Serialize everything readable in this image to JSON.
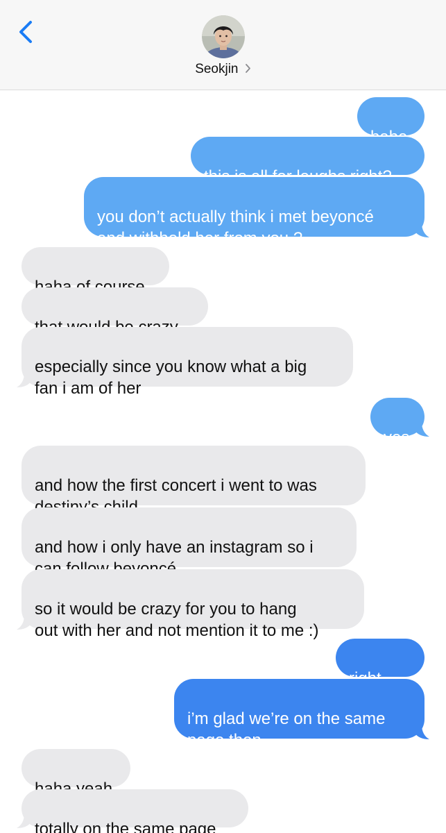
{
  "header": {
    "contact_name": "Seokjin",
    "icons": {
      "back": "chevron-left-icon",
      "contact_details": "chevron-right-icon",
      "avatar": "contact-avatar"
    },
    "colors": {
      "accent": "#1a7cf5",
      "background": "#f7f7f7"
    }
  },
  "conversation": {
    "colors": {
      "sent_bubble": "#5ea9f3",
      "sent_bubble_latest": "#3c85ef",
      "received_bubble": "#e9e9eb"
    },
    "messages": [
      {
        "from": "me",
        "text": "babe"
      },
      {
        "from": "me",
        "text": "this is all for laughs right?"
      },
      {
        "from": "me",
        "text": "you don’t actually think i met beyoncé\nand withheld her from you ?"
      },
      {
        "from": "them",
        "text": "haha of course"
      },
      {
        "from": "them",
        "text": "that would be crazy"
      },
      {
        "from": "them",
        "text": "especially since you know what a big\nfan i am of her"
      },
      {
        "from": "me",
        "text": "yes"
      },
      {
        "from": "them",
        "text": "and how the first concert i went to was\ndestiny’s child"
      },
      {
        "from": "them",
        "text": "and how i only have an instagram so i\ncan follow beyoncé"
      },
      {
        "from": "them",
        "text": "so it would be crazy for you to hang\nout with her and not mention it to me :)"
      },
      {
        "from": "me",
        "text": "right....."
      },
      {
        "from": "me",
        "text": "i’m glad we’re on the same\npage then..."
      },
      {
        "from": "them",
        "text": "haha yeah"
      },
      {
        "from": "them",
        "text": "totally on the same page"
      }
    ]
  }
}
